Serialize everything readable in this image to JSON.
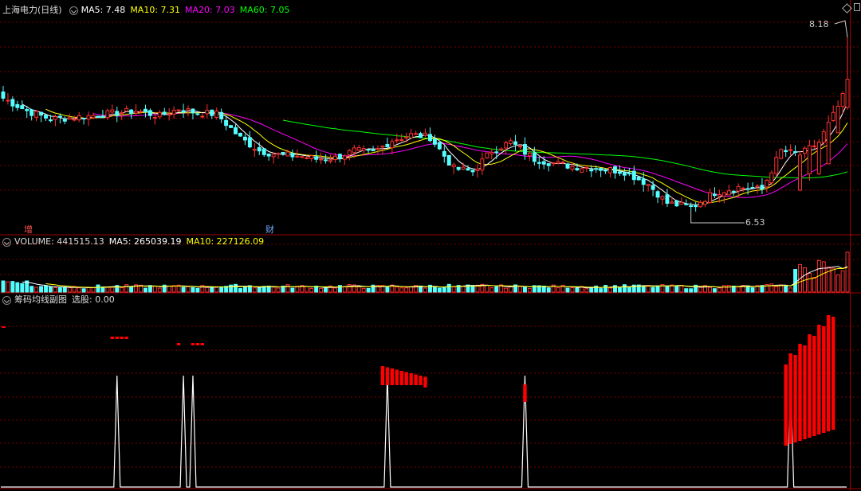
{
  "colors": {
    "up": "#ff3030",
    "down": "#54ffff",
    "ma5": "#ffffff",
    "ma10": "#ffff00",
    "ma20": "#ff00ff",
    "ma60": "#00ff00",
    "grid": "#7a0000",
    "axis": "#a00000",
    "signal_bar": "#ff0000",
    "white_line": "#ffffff"
  },
  "main_panel": {
    "title": "上海电力(日线)",
    "ma5_label": "MA5: 7.48",
    "ma10_label": "MA10: 7.31",
    "ma20_label": "MA20: 7.03",
    "ma60_label": "MA60: 7.05",
    "high_marker": "8.18",
    "low_marker": "6.53",
    "event_tag_1": "增",
    "event_tag_2": "财"
  },
  "volume_panel": {
    "volume_label": "VOLUME: 441515.13",
    "ma5_label": "MA5: 265039.19",
    "ma10_label": "MA10: 227126.09"
  },
  "indicator_panel": {
    "title": "筹码均线副图",
    "select_label": "选股: 0.00"
  },
  "chart_data": [
    {
      "type": "candlestick",
      "title": "上海电力(日线)",
      "visible_range": [
        6.35,
        8.4
      ],
      "marked_high": 8.18,
      "marked_low": 6.53,
      "close_anchors": [
        [
          0,
          7.6
        ],
        [
          5,
          7.48
        ],
        [
          10,
          7.4
        ],
        [
          16,
          7.42
        ],
        [
          22,
          7.45
        ],
        [
          28,
          7.48
        ],
        [
          33,
          7.43
        ],
        [
          37,
          7.5
        ],
        [
          41,
          7.46
        ],
        [
          45,
          7.45
        ],
        [
          50,
          7.22
        ],
        [
          54,
          7.1
        ],
        [
          58,
          7.06
        ],
        [
          62,
          7.05
        ],
        [
          66,
          7.02
        ],
        [
          70,
          7.03
        ],
        [
          74,
          7.1
        ],
        [
          78,
          7.08
        ],
        [
          82,
          7.2
        ],
        [
          86,
          7.25
        ],
        [
          90,
          7.23
        ],
        [
          95,
          6.93
        ],
        [
          99,
          6.9
        ],
        [
          103,
          7.1
        ],
        [
          107,
          7.18
        ],
        [
          112,
          7.02
        ],
        [
          116,
          6.98
        ],
        [
          120,
          6.95
        ],
        [
          126,
          6.93
        ],
        [
          131,
          6.9
        ],
        [
          136,
          6.78
        ],
        [
          140,
          6.6
        ],
        [
          145,
          6.56
        ],
        [
          150,
          6.7
        ],
        [
          155,
          6.75
        ],
        [
          160,
          6.73
        ],
        [
          164,
          7.1
        ],
        [
          168,
          7.06
        ],
        [
          172,
          7.18
        ],
        [
          176,
          7.52
        ],
        [
          178,
          7.7
        ]
      ],
      "ma5_latest": 7.48,
      "ma10_latest": 7.31,
      "ma20_latest": 7.03,
      "ma60_latest": 7.05
    },
    {
      "type": "bar",
      "title": "VOLUME",
      "latest": 441515.13,
      "ma5_latest": 265039.19,
      "ma10_latest": 227126.09
    },
    {
      "type": "bar",
      "title": "筹码均线副图",
      "select_value": 0.0,
      "red_bar_groups": [
        [
          23,
          26
        ],
        [
          37,
          37
        ],
        [
          40,
          42
        ],
        [
          80,
          89
        ],
        [
          110,
          110
        ],
        [
          165,
          175
        ]
      ],
      "spike_positions": [
        24,
        38,
        40,
        81,
        110,
        166
      ]
    }
  ]
}
